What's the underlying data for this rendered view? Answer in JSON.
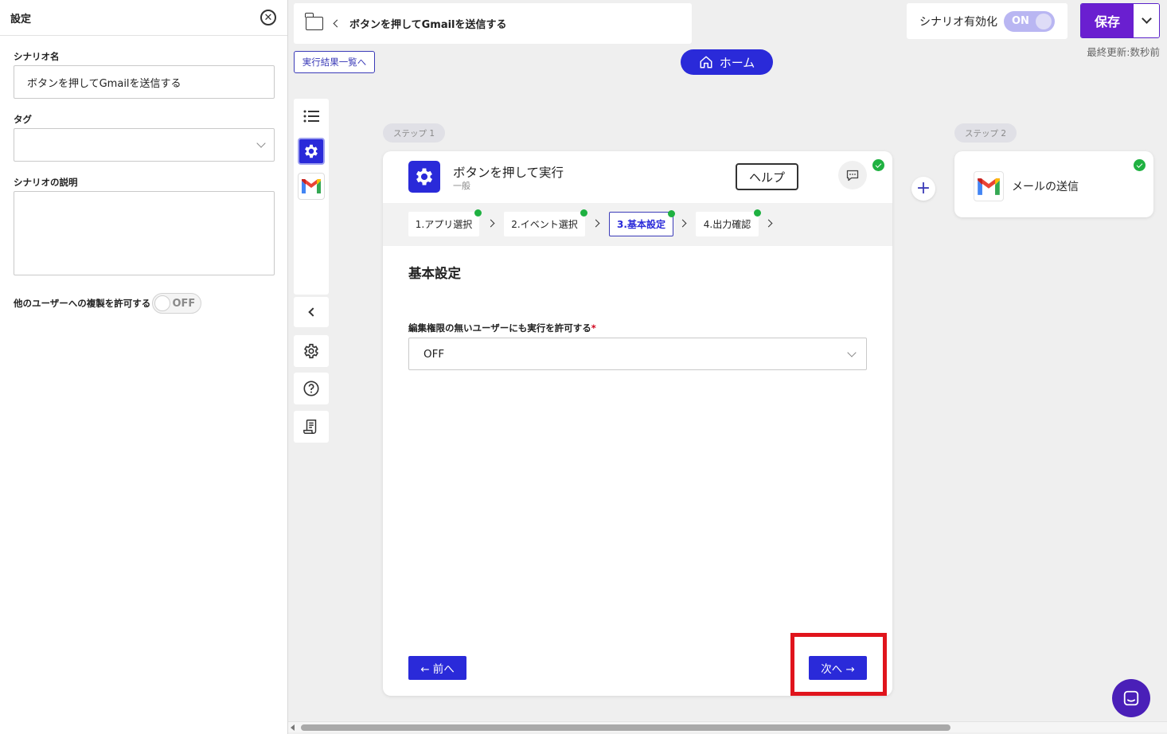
{
  "settings_panel": {
    "title": "設定",
    "scenario_name_label": "シナリオ名",
    "scenario_name_value": "ボタンを押してGmailを送信する",
    "tag_label": "タグ",
    "tag_value": "",
    "description_label": "シナリオの説明",
    "description_value": "",
    "copy_permission_label": "他のユーザーへの複製を許可する",
    "copy_permission_toggle": "OFF"
  },
  "header": {
    "breadcrumb_title": "ボタンを押してGmailを送信する",
    "results_link": "実行結果一覧へ",
    "home_button": "ホーム",
    "activate_label": "シナリオ有効化",
    "activate_toggle": "ON",
    "save_button": "保存",
    "last_updated": "最終更新:数秒前"
  },
  "steps": {
    "step1_label": "ステップ 1",
    "step2_label": "ステップ 2"
  },
  "main_card": {
    "title": "ボタンを押して実行",
    "subtitle": "一般",
    "help_button": "ヘルプ",
    "tabs": [
      {
        "label": "1.アプリ選択",
        "active": false,
        "done": true
      },
      {
        "label": "2.イベント選択",
        "active": false,
        "done": true
      },
      {
        "label": "3.基本設定",
        "active": true,
        "done": true
      },
      {
        "label": "4.出力確認",
        "active": false,
        "done": true
      }
    ],
    "section_title": "基本設定",
    "permission_label": "編集権限の無いユーザーにも実行を許可する",
    "permission_required_mark": "*",
    "permission_value": "OFF",
    "prev_button": "← 前へ",
    "next_button": "次へ →"
  },
  "step2_card": {
    "title": "メールの送信"
  },
  "colors": {
    "primary": "#2a2ad9",
    "save": "#6a1fd0",
    "success": "#1fb141",
    "highlight": "#e0141c"
  }
}
